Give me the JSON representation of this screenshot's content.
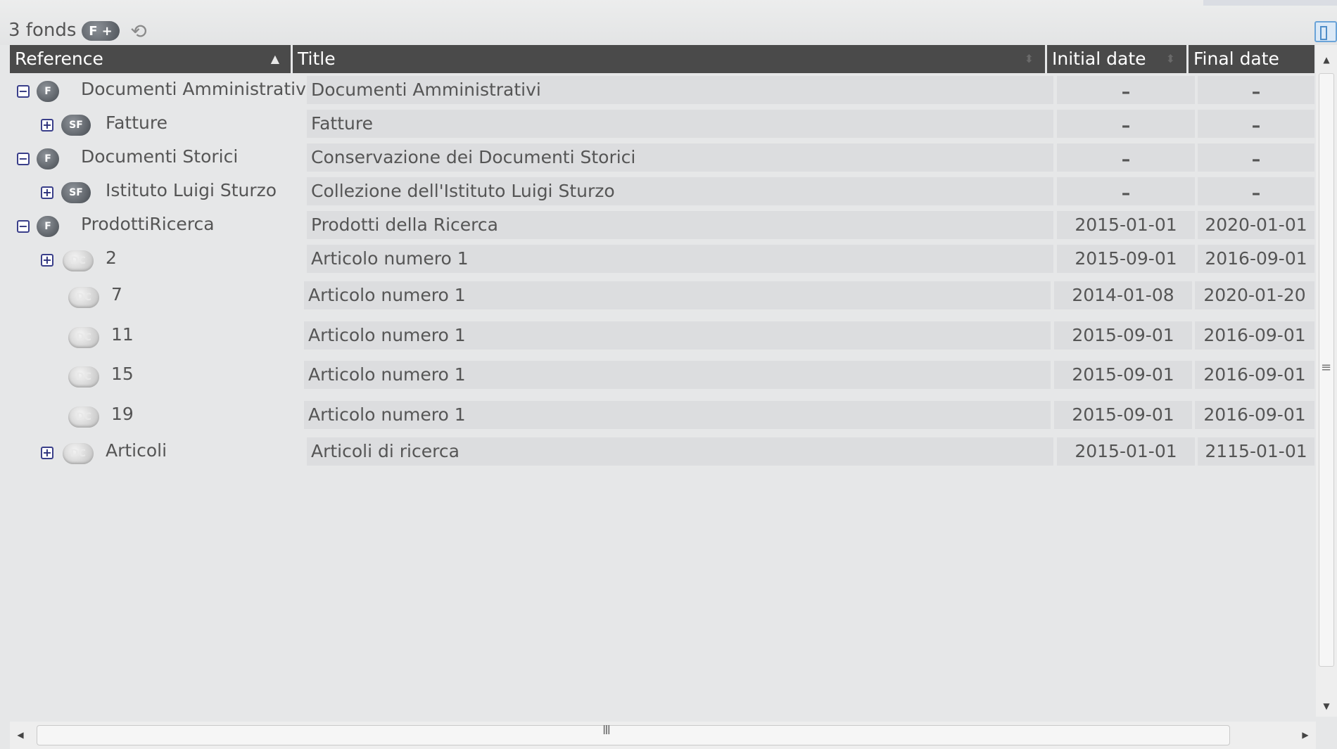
{
  "toolbar": {
    "fonds_count": "3 fonds",
    "add_fond_icon_letter": "F",
    "add_fond_plus": "+",
    "refresh_icon": "refresh-icon",
    "panel_toggle_icon": "panel-toggle-icon"
  },
  "columns": {
    "reference": "Reference",
    "title": "Title",
    "initial_date": "Initial date",
    "final_date": "Final date",
    "sort_asc": "▲",
    "sort_both": "⬍"
  },
  "rows": [
    {
      "reference": "Documenti Amministrativi",
      "icon": "F",
      "expander": "−",
      "title": "Documenti Amministrativi",
      "initial_date": "–",
      "final_date": "–"
    },
    {
      "reference": "Fatture",
      "icon": "SF",
      "expander": "+",
      "title": "Fatture",
      "initial_date": "–",
      "final_date": "–"
    },
    {
      "reference": "Documenti Storici",
      "icon": "F",
      "expander": "−",
      "title": "Conservazione dei Documenti Storici",
      "initial_date": "–",
      "final_date": "–"
    },
    {
      "reference": "Istituto Luigi Sturzo",
      "icon": "SF",
      "expander": "+",
      "title": "Collezione dell'Istituto Luigi Sturzo",
      "initial_date": "–",
      "final_date": "–"
    },
    {
      "reference": "ProdottiRicerca",
      "icon": "F",
      "expander": "−",
      "title": "Prodotti della Ricerca",
      "initial_date": "2015-01-01",
      "final_date": "2020-01-01"
    },
    {
      "reference": "2",
      "icon": "DC",
      "expander": "+",
      "title": "Articolo numero 1",
      "initial_date": "2015-09-01",
      "final_date": "2016-09-01"
    },
    {
      "reference": "7",
      "icon": "DC",
      "title": "Articolo numero 1",
      "initial_date": "2014-01-08",
      "final_date": "2020-01-20"
    },
    {
      "reference": "11",
      "icon": "DC",
      "title": "Articolo numero 1",
      "initial_date": "2015-09-01",
      "final_date": "2016-09-01"
    },
    {
      "reference": "15",
      "icon": "DC",
      "title": "Articolo numero 1",
      "initial_date": "2015-09-01",
      "final_date": "2016-09-01"
    },
    {
      "reference": "19",
      "icon": "DC",
      "title": "Articolo numero 1",
      "initial_date": "2015-09-01",
      "final_date": "2016-09-01"
    },
    {
      "reference": "Articoli",
      "icon": "DC",
      "expander": "+",
      "title": "Articoli di ricerca",
      "initial_date": "2015-01-01",
      "final_date": "2115-01-01"
    }
  ],
  "scrollbars": {
    "up": "▲",
    "down": "▼",
    "left": "◀",
    "right": "▶",
    "v_grip": "≡",
    "h_grip": "III"
  }
}
